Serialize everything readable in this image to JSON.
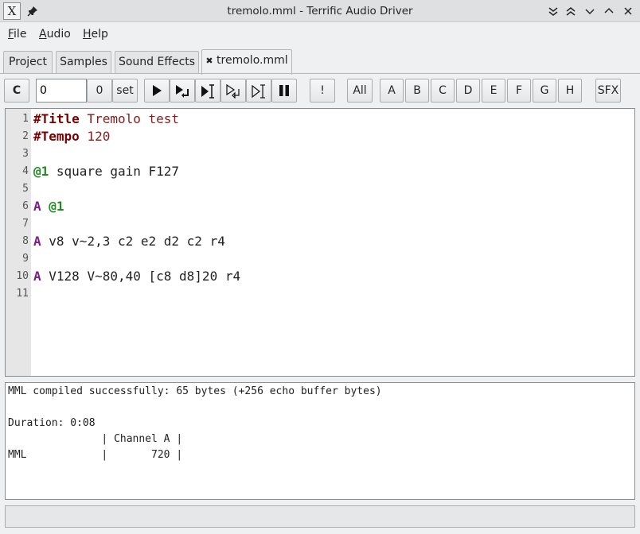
{
  "window": {
    "title": "tremolo.mml - Terrific Audio Driver",
    "app_icon": "X",
    "pin_icon": "📌",
    "buttons": [
      "⌄⌄",
      "⌃⌃",
      "⌄",
      "⌃",
      "✕"
    ]
  },
  "menu": {
    "file": {
      "mnemonic": "F",
      "rest": "ile"
    },
    "audio": {
      "mnemonic": "A",
      "rest": "udio"
    },
    "help": {
      "mnemonic": "H",
      "rest": "elp"
    }
  },
  "tabs": [
    {
      "label": "Project"
    },
    {
      "label": "Samples"
    },
    {
      "label": "Sound Effects"
    },
    {
      "label": "tremolo.mml",
      "close": "✖"
    }
  ],
  "toolbar": {
    "compile_label": "C",
    "bpm_value": "0",
    "zero_label": "0",
    "set_label": "set",
    "bang_label": "!",
    "all_label": "All",
    "channels": [
      "A",
      "B",
      "C",
      "D",
      "E",
      "F",
      "G",
      "H"
    ],
    "sfx_label": "SFX"
  },
  "editor": {
    "line_numbers": [
      "1",
      "2",
      "3",
      "4",
      "5",
      "6",
      "7",
      "8",
      "9",
      "10",
      "11"
    ],
    "lines": [
      [
        {
          "t": "#Title",
          "c": "kw-dir"
        },
        {
          "t": " Tremolo test",
          "c": "val-dir"
        }
      ],
      [
        {
          "t": "#Tempo",
          "c": "kw-dir"
        },
        {
          "t": " 120",
          "c": "val-dir"
        }
      ],
      [],
      [
        {
          "t": "@1",
          "c": "kw-inst"
        },
        {
          "t": " square gain F127",
          "c": ""
        }
      ],
      [],
      [
        {
          "t": "A",
          "c": "kw-chan"
        },
        {
          "t": " ",
          "c": ""
        },
        {
          "t": "@1",
          "c": "kw-inst"
        }
      ],
      [],
      [
        {
          "t": "A",
          "c": "kw-chan"
        },
        {
          "t": " v8 v~2,3 c2 e2 d2 c2 r4",
          "c": ""
        }
      ],
      [],
      [
        {
          "t": "A",
          "c": "kw-chan"
        },
        {
          "t": " V128 V~80,40 [c8 d8]20 r4",
          "c": ""
        }
      ],
      []
    ]
  },
  "output": {
    "lines": [
      "MML compiled successfully: 65 bytes (+256 echo buffer bytes)",
      "",
      "Duration: 0:08",
      "               | Channel A |",
      "MML            |       720 |"
    ]
  },
  "status": {
    "text": ""
  }
}
